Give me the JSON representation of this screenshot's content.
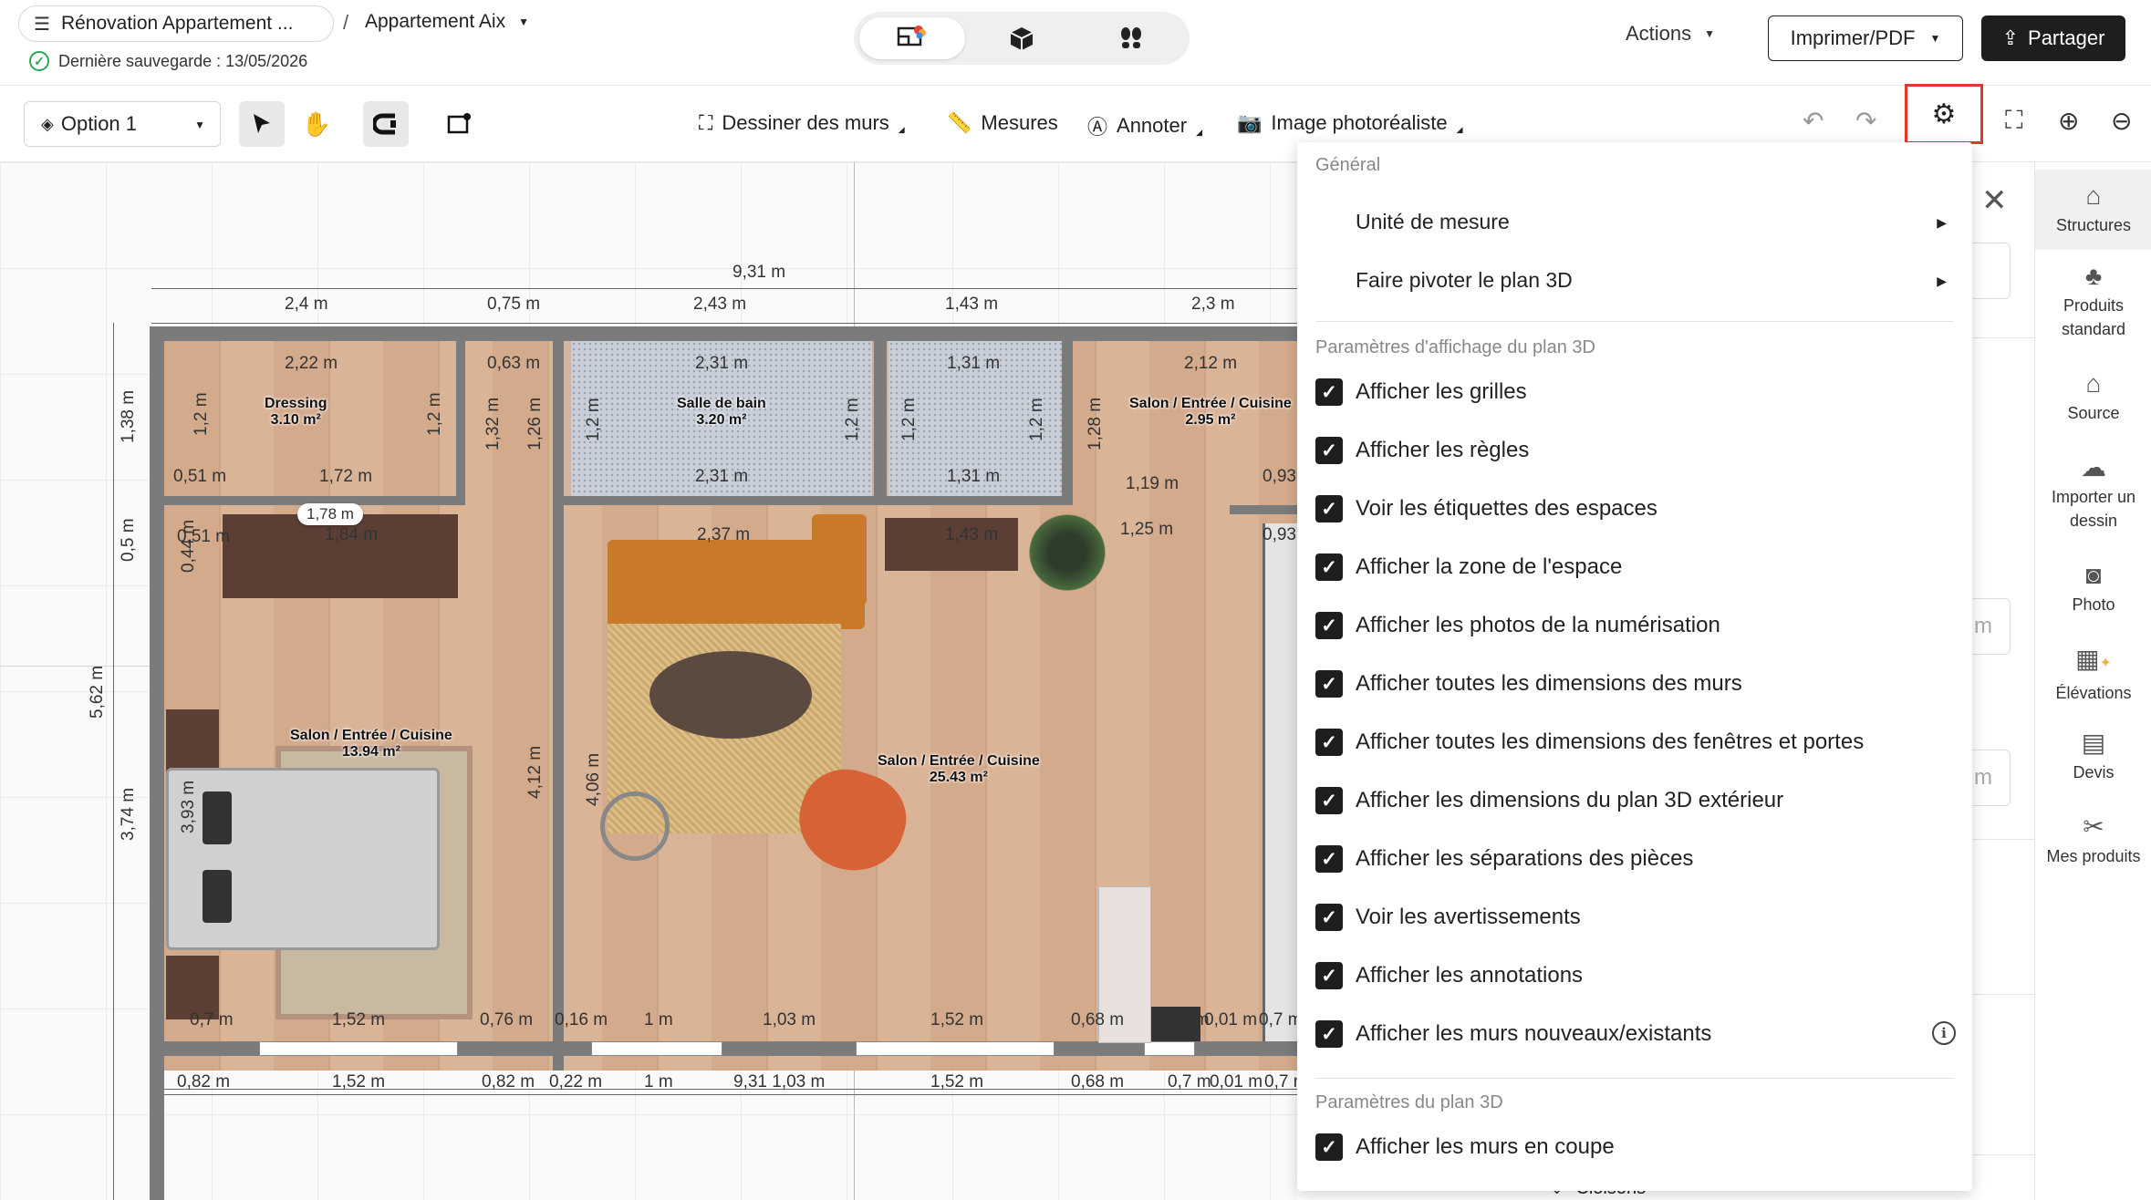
{
  "header": {
    "project_name": "Rénovation Appartement ...",
    "separator": "/",
    "plan_name": "Appartement Aix",
    "save_status": "Dernière sauvegarde : 13/05/2026",
    "actions_label": "Actions",
    "print_label": "Imprimer/PDF",
    "share_label": "Partager"
  },
  "toolbar": {
    "option_label": "Option 1",
    "draw_walls": "Dessiner des murs",
    "measures": "Mesures",
    "annotate": "Annoter",
    "photo_image": "Image photoréaliste"
  },
  "settings_menu": {
    "general_title": "Général",
    "unit": "Unité de mesure",
    "rotate": "Faire pivoter le plan 3D",
    "display_title": "Paramètres d'affichage du plan 3D",
    "options": [
      {
        "label": "Afficher les grilles",
        "checked": true
      },
      {
        "label": "Afficher les règles",
        "checked": true
      },
      {
        "label": "Voir les étiquettes des espaces",
        "checked": true
      },
      {
        "label": "Afficher la zone de l'espace",
        "checked": true
      },
      {
        "label": "Afficher les photos de la numérisation",
        "checked": true
      },
      {
        "label": "Afficher toutes les dimensions des murs",
        "checked": true
      },
      {
        "label": "Afficher toutes les dimensions des fenêtres et portes",
        "checked": true
      },
      {
        "label": "Afficher les dimensions du plan 3D extérieur",
        "checked": true
      },
      {
        "label": "Afficher les séparations des pièces",
        "checked": true
      },
      {
        "label": "Voir les avertissements",
        "checked": true
      },
      {
        "label": "Afficher les annotations",
        "checked": true
      },
      {
        "label": "Afficher les murs nouveaux/existants",
        "checked": true
      }
    ],
    "plan_title": "Paramètres du plan 3D",
    "plan_option": "Afficher les murs en coupe"
  },
  "sidebar": {
    "items": [
      {
        "label": "Structures",
        "icon": "structures-icon"
      },
      {
        "label": "Produits standard",
        "icon": "products-icon"
      },
      {
        "label": "Source",
        "icon": "source-icon"
      },
      {
        "label": "Importer un dessin",
        "icon": "import-icon"
      },
      {
        "label": "Photo",
        "icon": "camera-icon"
      },
      {
        "label": "Élévations",
        "icon": "elevations-icon"
      },
      {
        "label": "Devis",
        "icon": "quote-icon"
      },
      {
        "label": "Mes produits",
        "icon": "my-products-icon"
      }
    ]
  },
  "right_panel": {
    "unit_suffix_1": "m",
    "unit_suffix_2": "m",
    "cloisons_label": "Cloisons"
  },
  "plan": {
    "top_total": "9,31 m",
    "top_dims": [
      "2,4 m",
      "0,75 m",
      "2,43 m",
      "1,43 m",
      "2,3 m"
    ],
    "bottom_dims": [
      "0,82 m",
      "1,52 m",
      "0,82 m",
      "0,22 m",
      "1 m",
      "9,31 1,03 m",
      "1,52 m",
      "0,68 m",
      "0,7 m",
      "0,01 m",
      "0,7 m"
    ],
    "left_dims": [
      "1,38 m",
      "0,5 m",
      "5,62 m",
      "3,74 m"
    ],
    "rooms": [
      {
        "name": "Dressing",
        "area": "3.10 m²"
      },
      {
        "name": "Salle de bain",
        "area": "3.20 m²"
      },
      {
        "name": "Salon / Entrée / Cuisine",
        "area": "2.95 m²"
      },
      {
        "name": "Salon / Entrée / Cuisine",
        "area": "13.94 m²"
      },
      {
        "name": "Salon / Entrée / Cuisine",
        "area": "25.43 m²"
      }
    ],
    "inner_dims": {
      "dressing_top": "2,22 m",
      "dressing_bottom_left": "0,51 m",
      "dressing_bottom": "1,72 m",
      "d063": "0,63 m",
      "bath_top": "2,31 m",
      "bath_bottom": "2,31 m",
      "wc_top": "1,31 m",
      "wc_bottom": "1,31 m",
      "r212": "2,12 m",
      "r119": "1,19 m",
      "r093": "0,93",
      "r093b": "0,93",
      "badge": "1,78 m",
      "r184": "1,84 m",
      "r051b": "0,51 m",
      "sofa": "2,37 m",
      "desk": "1,43 m",
      "r125": "1,25 m",
      "b07": "0,7 m",
      "b152": "1,52 m",
      "b076": "0,76 m",
      "b016": "0,16 m",
      "b1": "1 m",
      "b103": "1,03 m",
      "b152b": "1,52 m",
      "b068": "0,68 m",
      "b07b": "0,7 m",
      "b001": "0,01 m",
      "b07c": "0,7 m",
      "v12a": "1,2 m",
      "v12b": "1,2 m",
      "v132": "1,32 m",
      "v126": "1,26 m",
      "v12c": "1,2 m",
      "v12d": "1,2 m",
      "v12e": "1,2 m",
      "v12f": "1,2 m",
      "v128": "1,28 m",
      "v412": "4,12 m",
      "v406": "4,06 m",
      "v393": "3,93 m",
      "v044": "0,44 m"
    }
  }
}
